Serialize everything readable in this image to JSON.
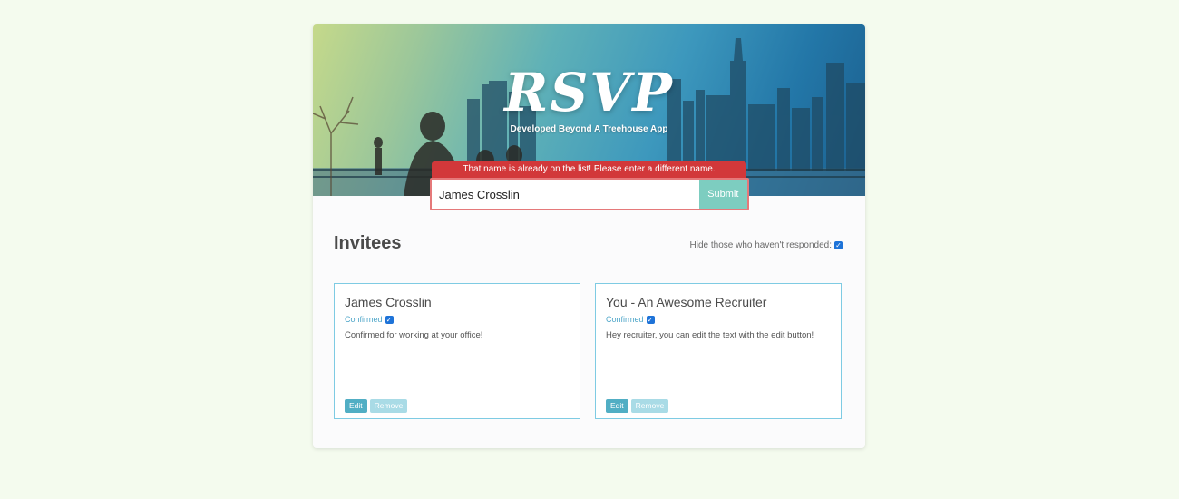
{
  "header": {
    "logo_text": "RSVP",
    "tagline": "Developed Beyond A Treehouse App"
  },
  "form": {
    "error_message": "That name is already on the list! Please enter a different name.",
    "input_value": "James Crosslin",
    "submit_label": "Submit"
  },
  "invitees": {
    "title": "Invitees",
    "filter_label": "Hide those who haven't responded:",
    "filter_checked": true,
    "cards": [
      {
        "name": "James Crosslin",
        "status_label": "Confirmed",
        "confirmed": true,
        "note": "Confirmed for working at your office!",
        "edit_label": "Edit",
        "remove_label": "Remove"
      },
      {
        "name": "You - An Awesome Recruiter",
        "status_label": "Confirmed",
        "confirmed": true,
        "note": "Hey recruiter, you can edit the text with the edit button!",
        "edit_label": "Edit",
        "remove_label": "Remove"
      }
    ]
  },
  "colors": {
    "page_background": "#f4fbee",
    "error": "#d2383a",
    "submit": "#7dcdc0",
    "card_border": "#7ecbe3",
    "status_text": "#4ea6c9",
    "checkbox": "#1e73d8"
  }
}
